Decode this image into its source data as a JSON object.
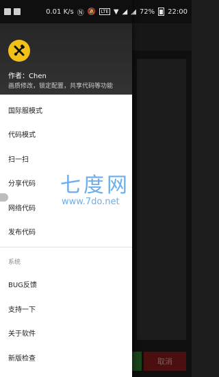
{
  "status_bar": {
    "network_speed": "0.01 K/s",
    "lte_badge": "LTE",
    "battery": "72%",
    "time": "22:00"
  },
  "drawer": {
    "author": "作者：Chen",
    "description": "画质修改，锁定配置，共享代码等功能",
    "items": [
      {
        "label": "国际服模式"
      },
      {
        "label": "代码模式"
      },
      {
        "label": "扫一扫"
      },
      {
        "label": "分享代码"
      },
      {
        "label": "网络代码"
      },
      {
        "label": "发布代码"
      }
    ],
    "section_label": "系统",
    "system_items": [
      {
        "label": "BUG反馈"
      },
      {
        "label": "支持一下"
      },
      {
        "label": "关于软件"
      },
      {
        "label": "新版检查"
      }
    ]
  },
  "background": {
    "cancel_label": "取消"
  },
  "watermark": {
    "title": "七度网",
    "url": "www.7do.net"
  }
}
